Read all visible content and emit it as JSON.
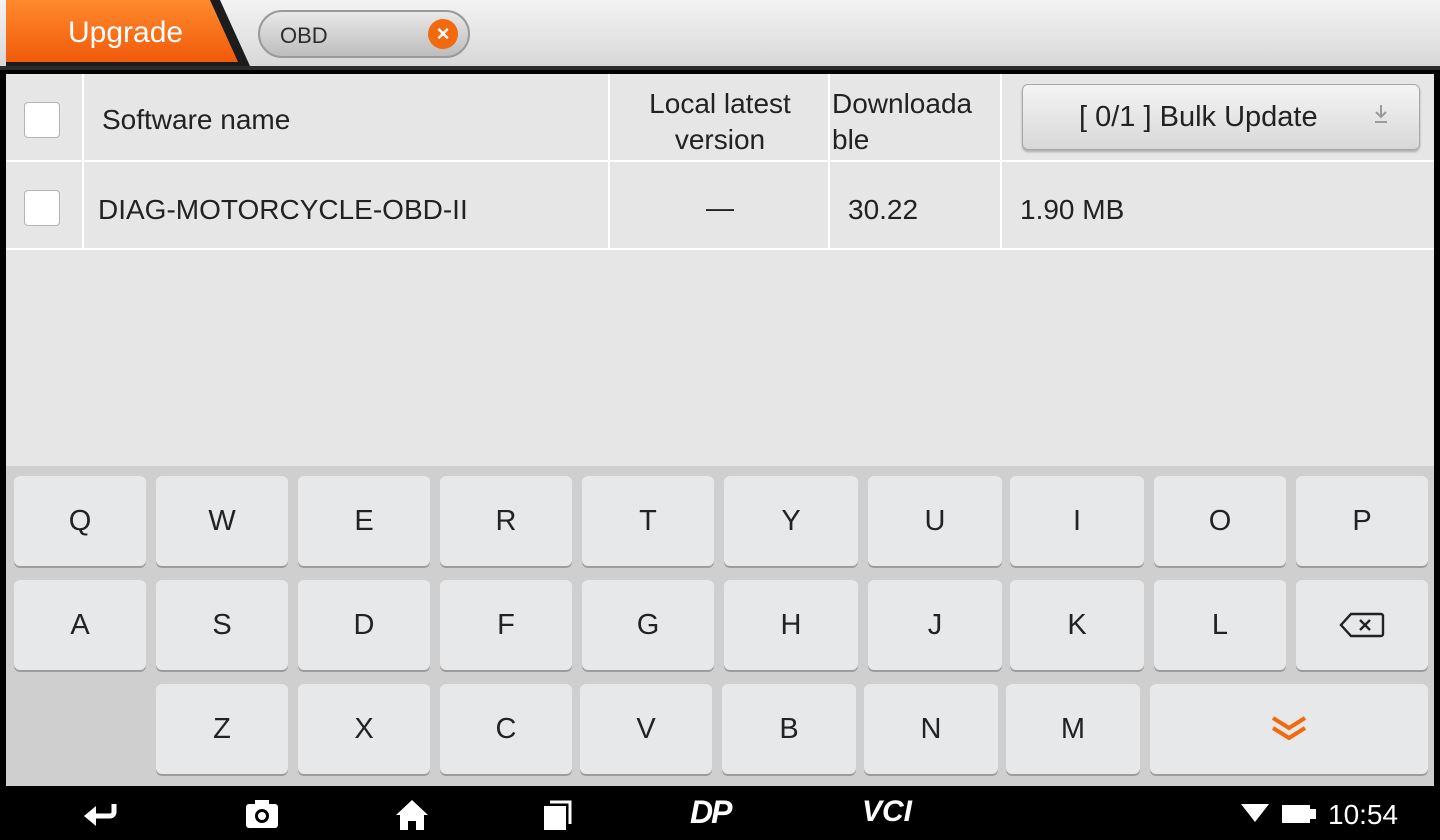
{
  "topbar": {
    "tab_label": "Upgrade",
    "search_text": "OBD",
    "accent_color": "#f26a10"
  },
  "table": {
    "headers": {
      "software_name": "Software name",
      "local_version_line1": "Local latest",
      "local_version_line2": "version",
      "downloadable_line1": "Downloada",
      "downloadable_line2": "ble",
      "bulk_update": "[ 0/1 ] Bulk Update"
    },
    "rows": [
      {
        "name": "DIAG-MOTORCYCLE-OBD-II",
        "local_version": "—",
        "downloadable": "30.22",
        "size": "1.90 MB"
      }
    ]
  },
  "keyboard": {
    "row1": [
      "Q",
      "W",
      "E",
      "R",
      "T",
      "Y",
      "U",
      "I",
      "O",
      "P"
    ],
    "row2": [
      "A",
      "S",
      "D",
      "F",
      "G",
      "H",
      "J",
      "K",
      "L"
    ],
    "row3": [
      "Z",
      "X",
      "C",
      "V",
      "B",
      "N",
      "M"
    ]
  },
  "navbar": {
    "dp_label": "DP",
    "vci_label": "VCI",
    "time": "10:54"
  }
}
